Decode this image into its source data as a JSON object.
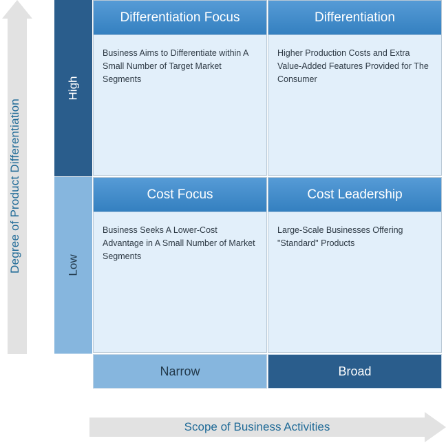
{
  "axes": {
    "y": {
      "label": "Degree of Product Differentiation",
      "arrow_direction": "up",
      "categories": [
        {
          "key": "high",
          "label": "High"
        },
        {
          "key": "low",
          "label": "Low"
        }
      ]
    },
    "x": {
      "label": "Scope of Business Activities",
      "arrow_direction": "right",
      "categories": [
        {
          "key": "narrow",
          "label": "Narrow"
        },
        {
          "key": "broad",
          "label": "Broad"
        }
      ]
    }
  },
  "quadrants": [
    {
      "key": "differentiation_focus",
      "title": "Differentiation Focus",
      "body": "Business Aims to Differentiate within A Small Number of Target Market Segments"
    },
    {
      "key": "differentiation",
      "title": "Differentiation",
      "body": "Higher Production Costs and Extra Value-Added Features Provided for The Consumer"
    },
    {
      "key": "cost_focus",
      "title": "Cost Focus",
      "body": "Business Seeks A Lower-Cost Advantage in A Small Number of Market Segments"
    },
    {
      "key": "cost_leadership",
      "title": "Cost Leadership",
      "body": "Large-Scale Businesses Offering \"Standard\" Products"
    }
  ],
  "colors": {
    "dark_blue": "#2A5D8C",
    "mid_blue": "#86B6DE",
    "header_blue_top": "#569BD6",
    "header_blue_bottom": "#3480C0",
    "body_blue": "#E2EFFA",
    "arrow_gray": "#E2E2E2",
    "axis_text_blue": "#1F6A97"
  }
}
